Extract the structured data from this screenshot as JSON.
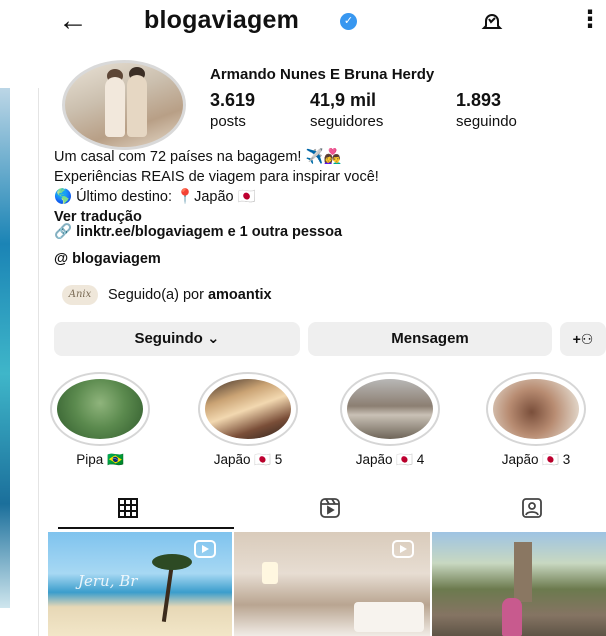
{
  "header": {
    "back_icon": "arrow-left-icon",
    "username": "blogaviagem",
    "verified_icon": "verified-badge-icon",
    "notify_icon": "bell-icon",
    "more_icon": "more-vertical-icon"
  },
  "profile": {
    "full_name": "Armando Nunes E Bruna Herdy",
    "stats": {
      "posts_value": "3.619",
      "posts_label": "posts",
      "followers_value": "41,9 mil",
      "followers_label": "seguidores",
      "following_value": "1.893",
      "following_label": "seguindo"
    },
    "bio": {
      "line1": "Um casal com 72 países na bagagem! ✈️👩‍❤️‍👨",
      "line2": "Experiências REAIS de viagem para inspirar você!",
      "line3": "🌎 Último destino: 📍Japão 🇯🇵",
      "translate": "Ver tradução"
    },
    "link_text": "linktr.ee/blogaviagem e 1 outra pessoa",
    "threads_handle": "blogaviagem",
    "followed_by_prefix": "Seguido(a) por ",
    "followed_by_user": "amoantix",
    "followed_avatar_text": "Anix"
  },
  "actions": {
    "following_label": "Seguindo ⌄",
    "message_label": "Mensagem",
    "add_user_label": "+⚇"
  },
  "highlights": [
    {
      "label": "Pipa 🇧🇷"
    },
    {
      "label": "Japão 🇯🇵 5"
    },
    {
      "label": "Japão 🇯🇵 4"
    },
    {
      "label": "Japão 🇯🇵 3"
    }
  ],
  "tabs": [
    {
      "icon": "grid-icon",
      "active": true
    },
    {
      "icon": "reels-icon",
      "active": false
    },
    {
      "icon": "tagged-icon",
      "active": false
    }
  ],
  "posts": [
    {
      "type": "reel",
      "overlay_text": "Jeru, Br"
    },
    {
      "type": "reel"
    },
    {
      "type": "photo"
    }
  ],
  "colors": {
    "verified": "#3897f0",
    "button_bg": "#efefef"
  }
}
